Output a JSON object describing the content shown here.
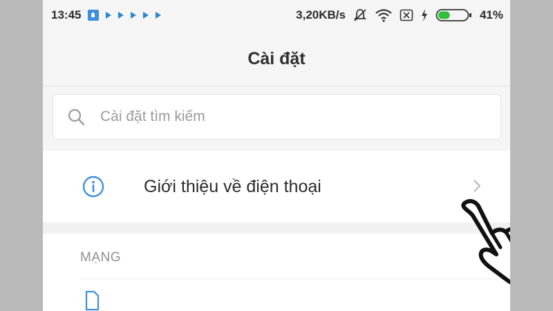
{
  "statusbar": {
    "time": "13:45",
    "speed": "3,20KB/s",
    "battery_percent": "41%",
    "battery_level": 0.41,
    "icons": [
      "notification-square-icon",
      "play-icon",
      "play-icon",
      "play-icon",
      "play-icon",
      "play-icon",
      "mute-icon",
      "wifi-icon",
      "sim-icon",
      "charging-icon",
      "battery-icon"
    ]
  },
  "header": {
    "title": "Cài đặt"
  },
  "search": {
    "placeholder": "Cài đặt tìm kiếm"
  },
  "rows": [
    {
      "label": "Giới thiệu về điện thoại",
      "icon": "info-icon"
    }
  ],
  "sections": [
    {
      "label": "MẠNG"
    }
  ],
  "colors": {
    "accent": "#3d8fe0",
    "battery_fill": "#2fbf3a",
    "background": "#f5f5f5"
  }
}
